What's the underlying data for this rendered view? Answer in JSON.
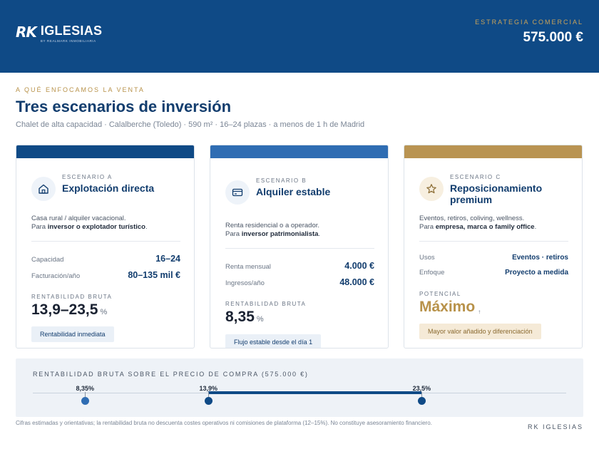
{
  "header": {
    "logo_mark": "RK",
    "logo_name": "IGLESIAS",
    "logo_sub": "BY REALMARK INMOBILIARIA",
    "label": "ESTRATEGIA COMERCIAL",
    "price": "575.000 €"
  },
  "intro": {
    "kicker": "A QUÉ ENFOCAMOS LA VENTA",
    "title": "Tres escenarios de inversión",
    "subtitle": "Chalet de alta capacidad · Calalberche (Toledo) · 590 m² · 16–24 plazas · a menos de 1 h de Madrid"
  },
  "cards": [
    {
      "tag": "ESCENARIO A",
      "name": "Explotación directa",
      "icon": "house-icon",
      "desc_line1": "Casa rural / alquiler vacacional.",
      "desc_prefix": "Para ",
      "desc_bold": "inversor o explotador turístico",
      "desc_suffix": ".",
      "rows": [
        {
          "label": "Capacidad",
          "value": "16–24"
        },
        {
          "label": "Facturación/año",
          "value": "80–135 mil €"
        }
      ],
      "metric_label": "RENTABILIDAD BRUTA",
      "metric": "13,9–23,5",
      "metric_unit": "%",
      "pill": "Rentabilidad inmediata"
    },
    {
      "tag": "ESCENARIO B",
      "name": "Alquiler estable",
      "icon": "card-icon",
      "desc_line1": "Renta residencial o a operador.",
      "desc_prefix": "Para ",
      "desc_bold": "inversor patrimonialista",
      "desc_suffix": ".",
      "rows": [
        {
          "label": "Renta mensual",
          "value": "4.000 €"
        },
        {
          "label": "Ingresos/año",
          "value": "48.000 €"
        }
      ],
      "metric_label": "RENTABILIDAD BRUTA",
      "metric": "8,35",
      "metric_unit": "%",
      "pill": "Flujo estable desde el día 1"
    },
    {
      "tag": "ESCENARIO C",
      "name": "Reposicionamiento premium",
      "icon": "star-icon",
      "desc_line1": "Eventos, retiros, coliving, wellness.",
      "desc_prefix": "Para ",
      "desc_bold": "empresa, marca o family office",
      "desc_suffix": ".",
      "rows": [
        {
          "label": "Usos",
          "value": "Eventos · retiros"
        },
        {
          "label": "Enfoque",
          "value": "Proyecto a medida"
        }
      ],
      "metric_label": "POTENCIAL",
      "metric": "Máximo",
      "metric_unit": "↑",
      "pill": "Mayor valor añadido y diferenciación"
    }
  ],
  "colors": {
    "navy": "#0f4a86",
    "blue": "#2f6db3",
    "gold": "#b99452"
  },
  "range_chart": {
    "label": "RENTABILIDAD BRUTA SOBRE EL PRECIO DE COMPRA (575.000 €)",
    "axis_min": 6,
    "axis_max": 30,
    "points": [
      {
        "label": "8,35%",
        "value": 8.35
      },
      {
        "label": "13,9%",
        "value": 13.9
      },
      {
        "label": "23,5%",
        "value": 23.5
      }
    ]
  },
  "footer": {
    "note": "Cifras estimadas y orientativas; la rentabilidad bruta no descuenta costes operativos ni comisiones de plataforma (12–15%). No constituye asesoramiento financiero.",
    "brand": "RK IGLESIAS"
  }
}
